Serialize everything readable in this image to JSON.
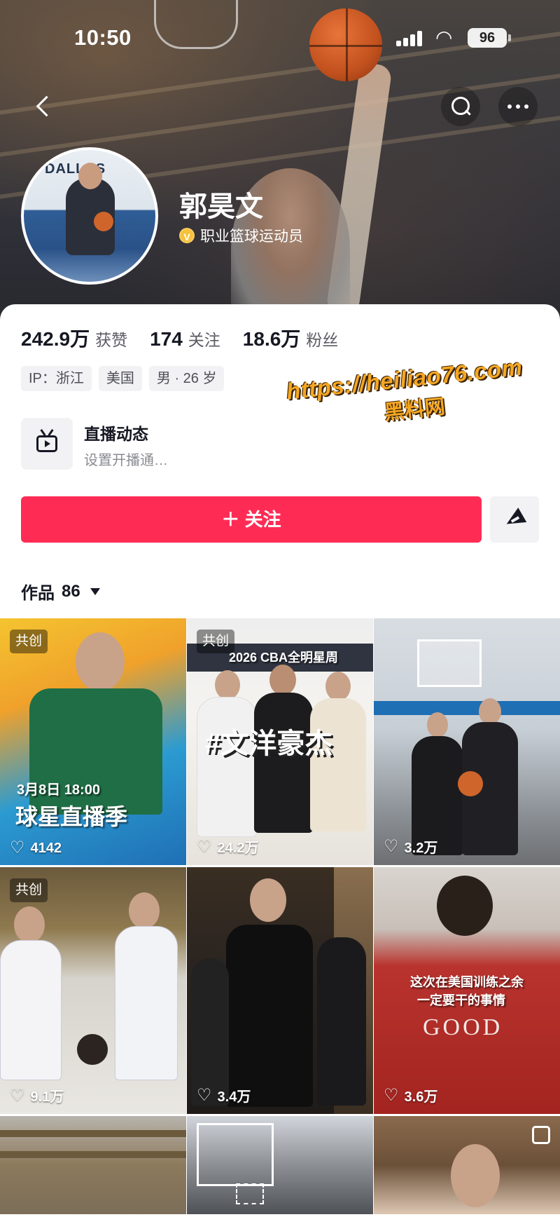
{
  "status_bar": {
    "time": "10:50",
    "battery": "96"
  },
  "profile": {
    "name": "郭昊文",
    "verified_icon": "V",
    "verification": "职业篮球运动员"
  },
  "stats": [
    {
      "num": "242.9万",
      "label": "获赞"
    },
    {
      "num": "174",
      "label": "关注"
    },
    {
      "num": "18.6万",
      "label": "粉丝"
    }
  ],
  "tags": [
    "IP：浙江",
    "美国",
    "男 · 26 岁"
  ],
  "live": {
    "title": "直播动态",
    "subtitle": "设置开播通…"
  },
  "watermark": {
    "line1": "https://heiliao76.com",
    "line2": "黑料网"
  },
  "actions": {
    "follow": "＋ 关注"
  },
  "works": {
    "label": "作品",
    "count": "86"
  },
  "videos": [
    {
      "badge": "共创",
      "likes": "4142",
      "overlay": "球星直播季",
      "overlay2": "3月8日 18:00"
    },
    {
      "badge": "共创",
      "likes": "24.2万",
      "overlay": "#文洋豪杰",
      "overlay2": "2026 CBA全明星周"
    },
    {
      "badge": "",
      "likes": "3.2万"
    },
    {
      "badge": "共创",
      "likes": "9.1万"
    },
    {
      "badge": "",
      "likes": "3.4万"
    },
    {
      "badge": "",
      "likes": "3.6万",
      "overlay": "这次在美国训练之余",
      "overlay2": "一定要干的事情"
    }
  ],
  "colors": {
    "follow_button": "#fe2c55",
    "verify_badge": "#f7c13b",
    "watermark": "#f5a623"
  },
  "icons": [
    "back-icon",
    "search-icon",
    "more-icon",
    "tv-icon",
    "share-icon",
    "heart-icon",
    "caret-down-icon"
  ]
}
